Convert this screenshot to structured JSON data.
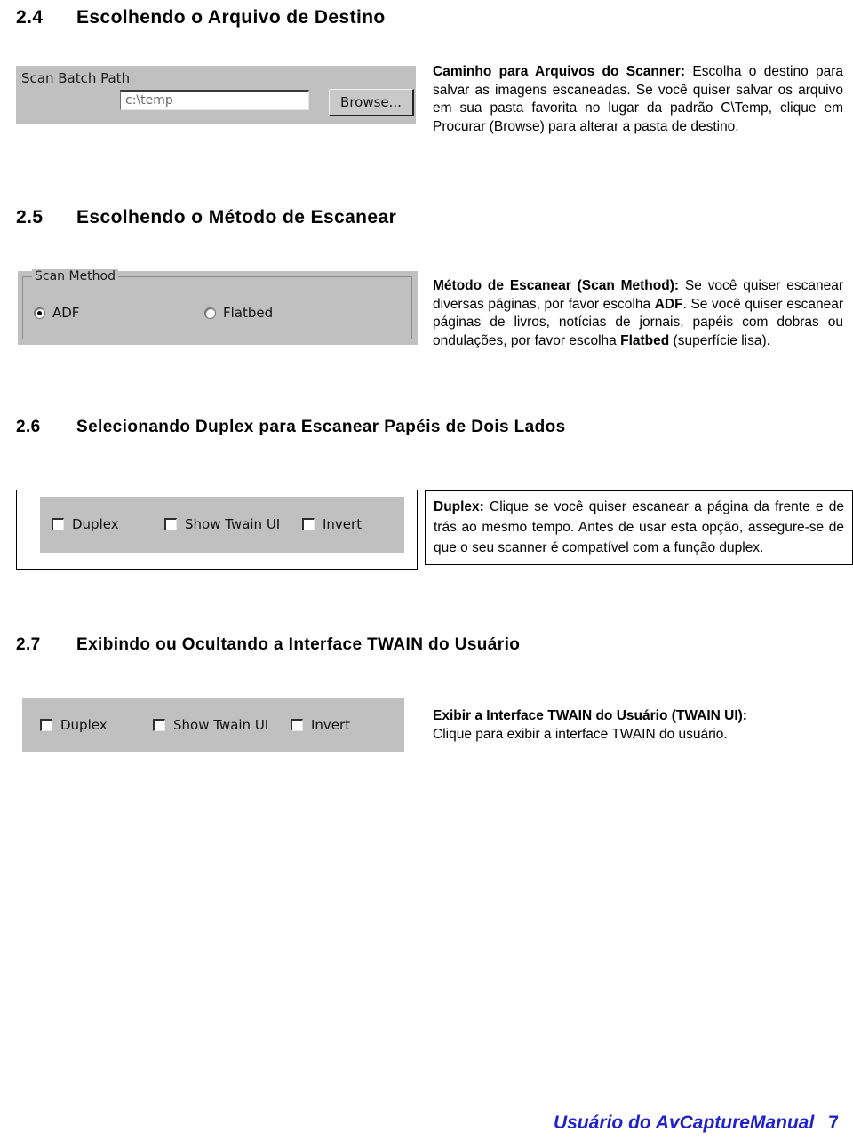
{
  "sections": [
    {
      "number": "2.4",
      "title": "Escolhendo o Arquivo de Destino"
    },
    {
      "number": "2.5",
      "title": "Escolhendo o Método de Escanear"
    },
    {
      "number": "2.6",
      "title": "Selecionando Duplex para Escanear Papéis de Dois Lados"
    },
    {
      "number": "2.7",
      "title": "Exibindo ou Ocultando a Interface TWAIN do Usuário"
    }
  ],
  "scan_batch_panel": {
    "label": "Scan Batch Path",
    "path_value": "c:\\temp",
    "path_placeholder": "c:\\temp",
    "browse_label": "Browse..."
  },
  "scan_method_panel": {
    "group_title": "Scan Method",
    "options": [
      {
        "label": "ADF",
        "selected": true
      },
      {
        "label": "Flatbed",
        "selected": false
      }
    ]
  },
  "duplex_panel_1": {
    "checkboxes": [
      {
        "label": "Duplex",
        "checked": false
      },
      {
        "label": "Show Twain UI",
        "checked": false
      },
      {
        "label": "Invert",
        "checked": false
      }
    ]
  },
  "duplex_panel_2": {
    "checkboxes": [
      {
        "label": "Duplex",
        "checked": false
      },
      {
        "label": "Show Twain UI",
        "checked": false
      },
      {
        "label": "Invert",
        "checked": false
      }
    ]
  },
  "descriptions": {
    "scan_batch": {
      "term": "Caminho para Arquivos do Scanner:",
      "body": " Escolha o destino para salvar as imagens escaneadas. Se você quiser salvar os arquivo em sua pasta favorita no lugar da padrão C\\Temp, clique em Procurar (Browse) para alterar a pasta de destino."
    },
    "scan_method": {
      "term": "Método de Escanear (Scan Method):",
      "body_1": " Se você quiser escanear diversas páginas, por favor escolha ",
      "emph_1": "ADF",
      "body_2": ". Se você quiser escanear páginas de livros, notícias de jornais, papéis com dobras ou ondulações, por favor escolha ",
      "emph_2": "Flatbed",
      "body_3": " (superfície lisa)."
    },
    "duplex": {
      "term": "Duplex:",
      "body": " Clique se você quiser escanear a página da frente e de trás ao mesmo tempo. Antes de usar esta opção, assegure-se de que o seu scanner é compatível com a função duplex."
    },
    "twain_ui": {
      "term": "Exibir a Interface TWAIN do Usuário (TWAIN UI):",
      "body": "Clique para exibir a interface TWAIN do usuário."
    }
  },
  "footer": {
    "text": "Usuário do AvCaptureManual",
    "page_number": "7",
    "color": "#2222cc"
  }
}
